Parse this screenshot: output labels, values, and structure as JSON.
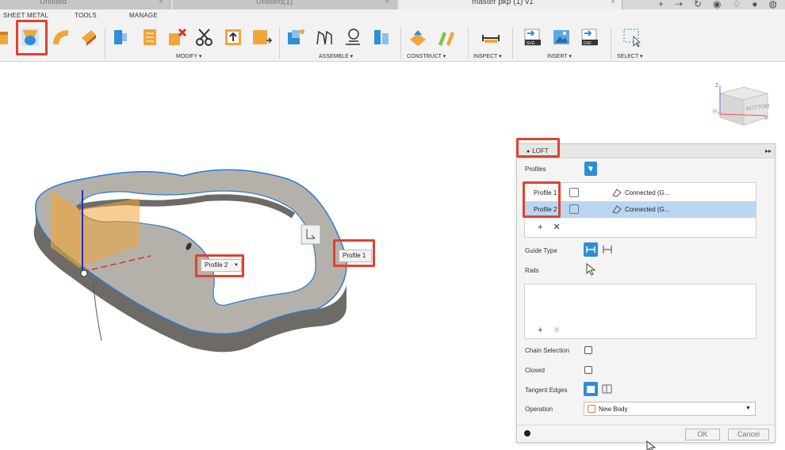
{
  "tabs": [
    {
      "label": "Untitled",
      "active": false
    },
    {
      "label": "Untitled(1)",
      "active": false
    },
    {
      "label": "master pkp (1) v1",
      "active": true
    }
  ],
  "menus": {
    "sheet_metal": "SHEET METAL",
    "tools": "TOOLS",
    "manage": "MANAGE"
  },
  "groups": {
    "modify": "MODIFY ▾",
    "assemble": "ASSEMBLE ▾",
    "construct": "CONSTRUCT ▾",
    "inspect": "INSPECT ▾",
    "insert": "INSERT ▾",
    "select": "SELECT ▾"
  },
  "ribbon_icons": {
    "svg": "SVG",
    "dxf": "DXF"
  },
  "viewcube": {
    "face_label": "BOTTOM",
    "axis_x": "X",
    "axis_y": "Y",
    "axis_z": "Z"
  },
  "viewport_tags": {
    "profile2": "Profile 2",
    "profile1": "Profile 1"
  },
  "loft_panel": {
    "title": "LOFT",
    "expand": "▸▸",
    "profiles_label": "Profiles",
    "rows": [
      {
        "name": "Profile 1",
        "continuity": "Connected (G..."
      },
      {
        "name": "Profile 2",
        "continuity": "Connected (G..."
      }
    ],
    "add": "+",
    "remove": "✕",
    "guide_type_label": "Guide Type",
    "rails_label": "Rails",
    "chain_selection_label": "Chain Selection",
    "closed_label": "Closed",
    "tangent_edges_label": "Tangent Edges",
    "operation_label": "Operation",
    "operation_value": "New Body",
    "ok": "OK",
    "cancel": "Cancel"
  },
  "colors": {
    "highlight_red": "#e0422f",
    "accent_blue": "#2d8fd5",
    "selection_blue": "#b9d6f2",
    "body_top": "#b4b1ab",
    "body_side": "#6e6b66",
    "sketch_orange": "#f0a63a"
  }
}
